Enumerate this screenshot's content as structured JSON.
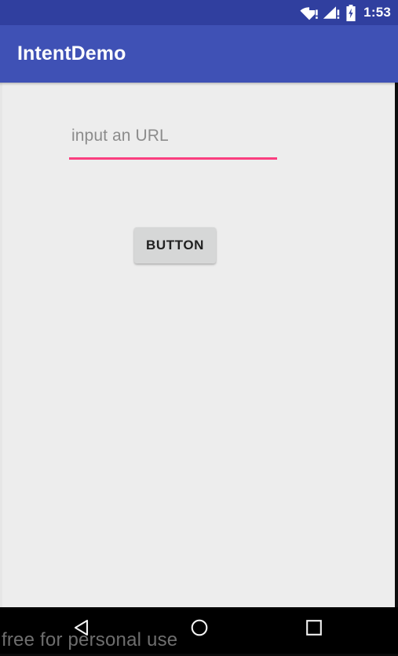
{
  "status_bar": {
    "background_color": "#303F9F",
    "clock": "1:53",
    "icons": [
      {
        "name": "wifi-alert-icon",
        "label": "WiFi, no internet"
      },
      {
        "name": "cellular-alert-icon",
        "label": "Cellular signal, no service"
      },
      {
        "name": "battery-charging-icon",
        "label": "Battery charging"
      }
    ]
  },
  "app_bar": {
    "background_color": "#3F51B5",
    "title": "IntentDemo"
  },
  "content": {
    "background_color": "#EDEDED",
    "url_input": {
      "placeholder": "input an URL",
      "value": "",
      "underline_color": "#FA3E7F"
    },
    "action_button": {
      "label": "BUTTON",
      "background_color": "#D6D7D7"
    }
  },
  "nav_bar": {
    "background_color": "#000000",
    "buttons": [
      {
        "name": "nav-back-button",
        "label": "Back"
      },
      {
        "name": "nav-home-button",
        "label": "Home"
      },
      {
        "name": "nav-recents-button",
        "label": "Recents"
      }
    ]
  },
  "watermark": {
    "text": "free for personal use"
  }
}
